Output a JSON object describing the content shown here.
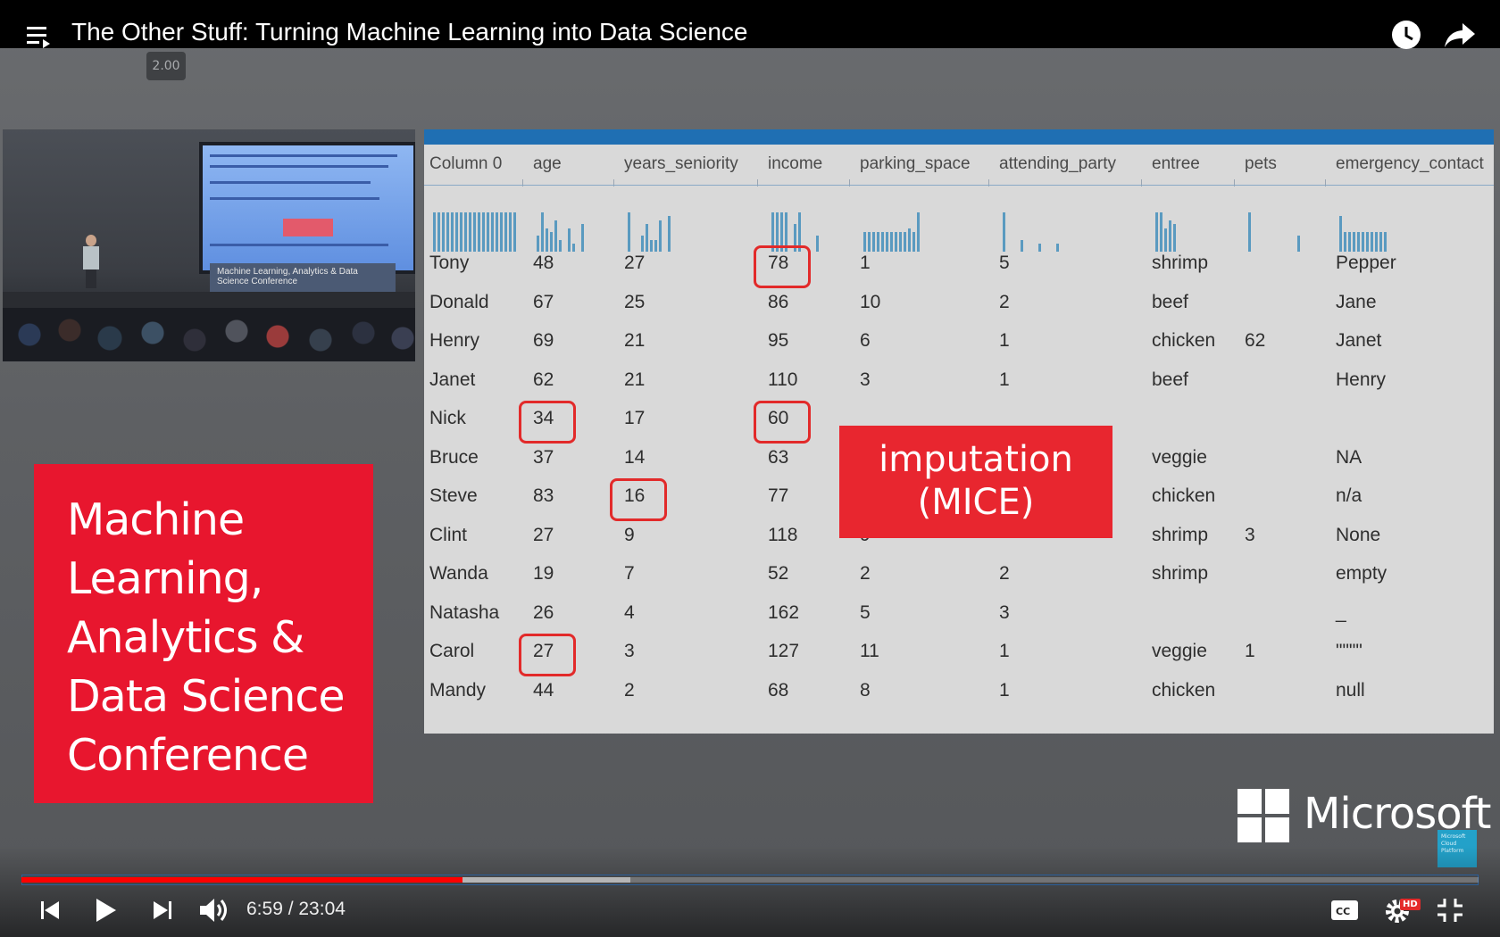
{
  "player": {
    "title": "The Other Stuff: Turning Machine Learning into Data Science",
    "speed_tooltip": "2.00",
    "time_display": "6:59 / 23:04",
    "progress_played": 0.303,
    "progress_buffered": 0.418,
    "hd_badge": "HD",
    "icons": [
      "playlist-icon",
      "watch-later-icon",
      "share-icon",
      "previous-icon",
      "play-icon",
      "next-icon",
      "volume-icon",
      "captions-icon",
      "settings-icon",
      "exit-fullscreen-icon"
    ]
  },
  "camera": {
    "banner_text": "Machine Learning, Analytics & Data Science Conference"
  },
  "conference_card": {
    "text": "Machine\nLearning,\nAnalytics &\nData Science\nConference"
  },
  "table": {
    "columns": [
      "Column 0",
      "age",
      "years_seniority",
      "income",
      "parking_space",
      "attending_party",
      "entree",
      "pets",
      "emergency_contact"
    ],
    "rows": [
      [
        "Tony",
        "48",
        "27",
        "78",
        "1",
        "5",
        "shrimp",
        "",
        "Pepper"
      ],
      [
        "Donald",
        "67",
        "25",
        "86",
        "10",
        "2",
        "beef",
        "",
        "Jane"
      ],
      [
        "Henry",
        "69",
        "21",
        "95",
        "6",
        "1",
        "chicken",
        "62",
        "Janet"
      ],
      [
        "Janet",
        "62",
        "21",
        "110",
        "3",
        "1",
        "beef",
        "",
        "Henry"
      ],
      [
        "Nick",
        "34",
        "17",
        "60",
        "",
        "",
        "",
        "",
        ""
      ],
      [
        "Bruce",
        "37",
        "14",
        "63",
        "",
        "",
        "veggie",
        "",
        "NA"
      ],
      [
        "Steve",
        "83",
        "16",
        "77",
        "",
        "",
        "chicken",
        "",
        "n/a"
      ],
      [
        "Clint",
        "27",
        "9",
        "118",
        "9",
        "",
        "shrimp",
        "3",
        "None"
      ],
      [
        "Wanda",
        "19",
        "7",
        "52",
        "2",
        "2",
        "shrimp",
        "",
        "empty"
      ],
      [
        "Natasha",
        "26",
        "4",
        "162",
        "5",
        "3",
        "",
        "",
        "_"
      ],
      [
        "Carol",
        "27",
        "3",
        "127",
        "11",
        "1",
        "veggie",
        "1",
        "\"\"\"\""
      ],
      [
        "Mandy",
        "44",
        "2",
        "68",
        "8",
        "1",
        "chicken",
        "",
        "null"
      ]
    ],
    "highlighted": [
      [
        0,
        3
      ],
      [
        4,
        1
      ],
      [
        4,
        3
      ],
      [
        6,
        2
      ],
      [
        10,
        1
      ]
    ],
    "overlay_label": "imputation\n(MICE)"
  },
  "branding": {
    "company": "Microsoft",
    "badge_text": "Microsoft Cloud Platform"
  },
  "colors": {
    "accent_red": "#e8162e",
    "progress_red": "#ff0000",
    "slide_blue": "#1f6fb3",
    "histogram": "#5a9ac0"
  }
}
